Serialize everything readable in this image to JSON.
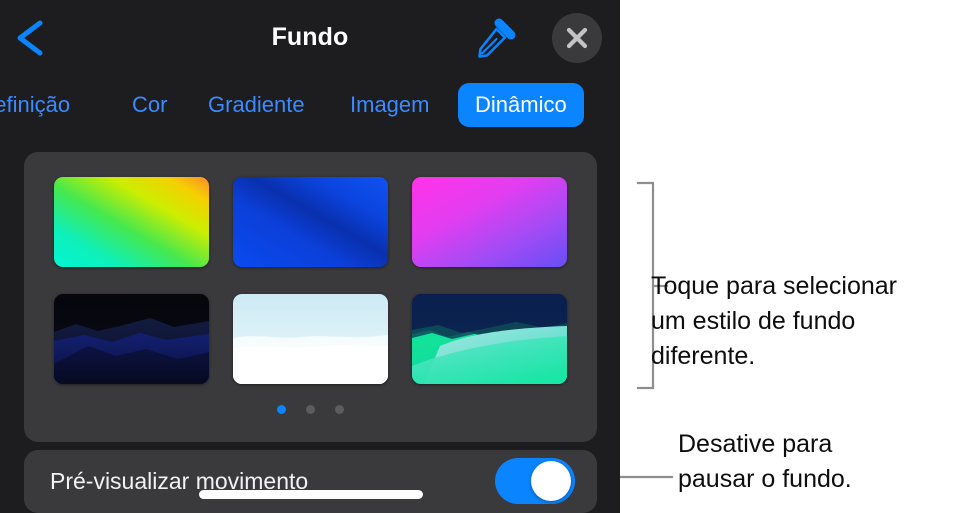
{
  "panel": {
    "header": {
      "title": "Fundo",
      "back_icon": "chevron-left-icon",
      "eyedropper_icon": "eyedropper-icon",
      "close_icon": "close-icon"
    },
    "tabs": [
      {
        "label": "definição",
        "selected": false
      },
      {
        "label": "Cor",
        "selected": false
      },
      {
        "label": "Gradiente",
        "selected": false
      },
      {
        "label": "Imagem",
        "selected": false
      },
      {
        "label": "Dinâmico",
        "selected": true
      }
    ],
    "thumbnails": [
      {
        "name": "thumbnail-green-yellow-gradient",
        "selected": false
      },
      {
        "name": "thumbnail-blue-gradient",
        "selected": false
      },
      {
        "name": "thumbnail-magenta-purple-gradient",
        "selected": false
      },
      {
        "name": "thumbnail-night-mountains",
        "selected": false
      },
      {
        "name": "thumbnail-white-snow",
        "selected": false
      },
      {
        "name": "thumbnail-teal-dunes",
        "selected": false
      }
    ],
    "page_dots": {
      "count": 3,
      "active_index": 0
    },
    "toggle_row": {
      "label": "Pré-visualizar movimento",
      "state": "on"
    }
  },
  "callouts": {
    "thumbnails": "Toque para selecionar\num estilo de fundo\ndiferente.",
    "toggle": "Desative para\npausar o fundo."
  },
  "colors": {
    "accent_blue": "#0a84ff",
    "tab_blue": "#3b8aff",
    "panel_bg": "#1d1d1f",
    "card_bg": "#3a3a3c",
    "dot_inactive": "#5c5c5e",
    "callout_line": "#8e8e8e",
    "text_primary": "#ffffff",
    "callout_text": "#0d0d0d"
  }
}
